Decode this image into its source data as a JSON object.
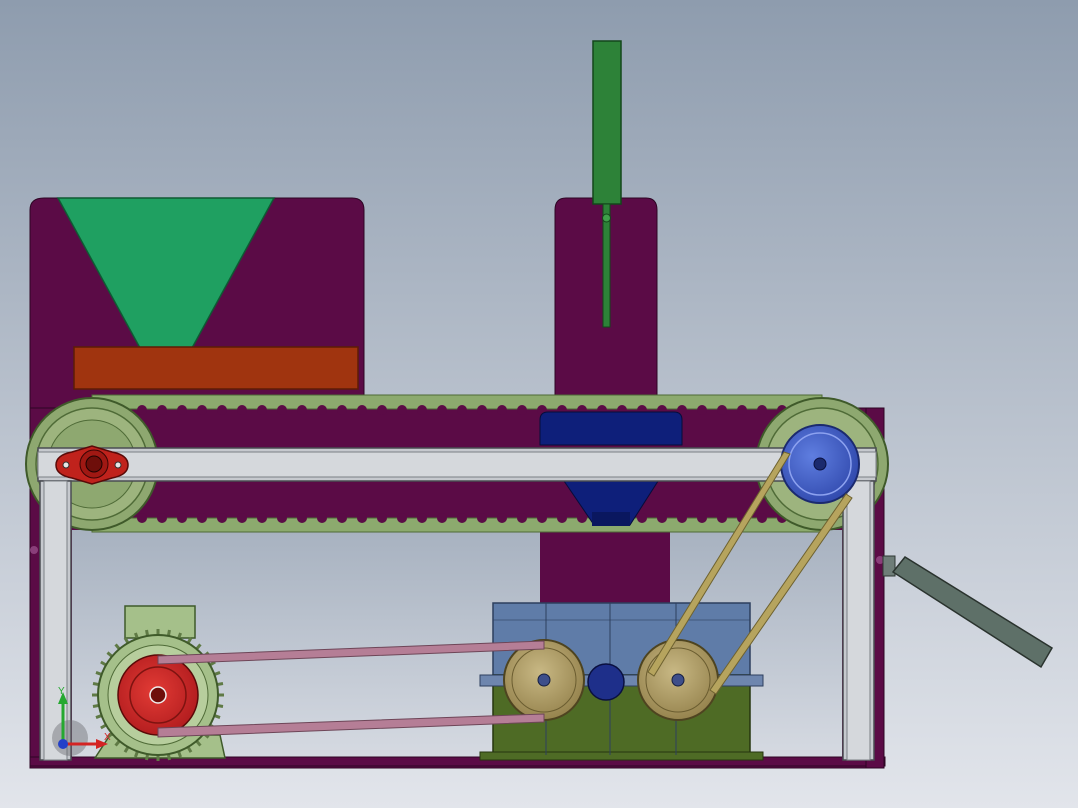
{
  "viewport": {
    "background_top": "#8E9CAE",
    "background_bottom": "#E2E5EB"
  },
  "colors": {
    "frame_plate": "#5B0B46",
    "frame_steel": "#C6C9CE",
    "hopper": "#1FA061",
    "press_pad": "#A0340F",
    "conveyor_belt": "#8CAA6E",
    "pulley_green": "#8EA870",
    "pulley_blue": "#4563C7",
    "pillow_block": "#C0221C",
    "cylinder": "#2D8238",
    "funnel": "#0E1F7A",
    "motor_body": "#A5C08A",
    "motor_pulley": "#D0262A",
    "gearbox_top": "#5F7CA8",
    "gearbox_bottom": "#4E6B25",
    "gear_pulley": "#A8965E",
    "v_belt_pink": "#B57E96",
    "v_belt_gold": "#B6A45E",
    "chute": "#5E7068"
  },
  "icons": {
    "triad": "coordinate-triad-icon",
    "bearing": "pillow-block-bearing-icon"
  },
  "triad": {
    "x_label": "X",
    "y_label": "Y"
  }
}
